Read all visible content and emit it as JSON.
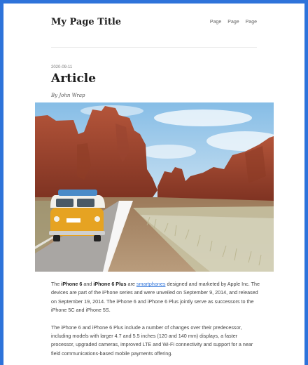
{
  "header": {
    "site_title": "My Page Title",
    "nav": [
      "Page",
      "Page",
      "Page"
    ]
  },
  "article": {
    "date": "2020-09-11",
    "title": "Article",
    "byline": "By John Wrap",
    "paragraph1": {
      "pre1": "The ",
      "bold1": "iPhone 6",
      "mid1": " and ",
      "bold2": "iPhone 6 Plus",
      "mid2": " are ",
      "link": "smartphones",
      "rest": " designed and marketed by Apple Inc. The devices are part of the iPhone series and were unveiled on September 9, 2014, and released on September 19, 2014. The iPhone 6 and iPhone 6 Plus jointly serve as successors to the iPhone 5C and iPhone 5S."
    },
    "paragraph2": "The iPhone 6 and iPhone 6 Plus include a number of changes over their predecessor, including models with larger 4.7 and 5.5 inches (120 and 140 mm) displays, a faster processor, upgraded cameras, improved LTE and Wi-Fi connectivity and support for a near field communications-based mobile payments offering."
  },
  "colors": {
    "frame": "#2e73da",
    "link": "#2e73da"
  }
}
